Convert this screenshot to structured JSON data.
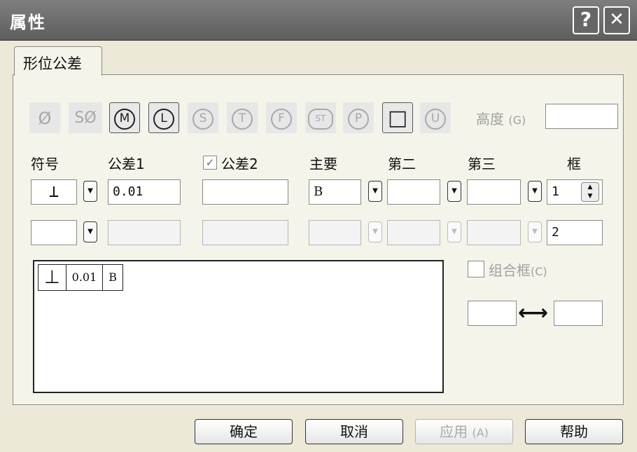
{
  "window": {
    "title": "属性",
    "help_glyph": "?",
    "close_glyph": "✕"
  },
  "tab": {
    "label": "形位公差"
  },
  "symbols": [
    {
      "name": "diameter",
      "text": "Ø",
      "state": "disabled"
    },
    {
      "name": "spherical-diameter",
      "text": "SØ",
      "state": "disabled"
    },
    {
      "name": "m",
      "text": "M",
      "state": "on"
    },
    {
      "name": "l",
      "text": "L",
      "state": "on"
    },
    {
      "name": "s",
      "text": "S",
      "state": "disabled"
    },
    {
      "name": "t",
      "text": "T",
      "state": "disabled"
    },
    {
      "name": "f",
      "text": "F",
      "state": "disabled"
    },
    {
      "name": "st",
      "text": "ST",
      "state": "disabled"
    },
    {
      "name": "p",
      "text": "P",
      "state": "disabled"
    },
    {
      "name": "square",
      "text": "□",
      "state": "on"
    },
    {
      "name": "u",
      "text": "U",
      "state": "disabled"
    }
  ],
  "height": {
    "label": "高度",
    "accel": "(G)",
    "value": ""
  },
  "headers": {
    "symbol": "符号",
    "tol1": "公差1",
    "tol2": "公差2",
    "primary": "主要",
    "second": "第二",
    "third": "第三",
    "frame": "框"
  },
  "tol2_checked": true,
  "row1": {
    "symbol": "⊥",
    "tol1": "0.01",
    "tol2": "",
    "primary": "B",
    "second": "",
    "third": "",
    "frame": "1"
  },
  "row2": {
    "symbol": "",
    "tol1": "",
    "tol2": "",
    "primary": "",
    "second": "",
    "third": "",
    "frame": "2"
  },
  "preview": {
    "symbol": "⊥",
    "value": "0.01",
    "datum": "B"
  },
  "composite": {
    "label": "组合框",
    "accel": "(C)",
    "checked": false,
    "left": "",
    "right": "",
    "arrow": "⟷"
  },
  "buttons": {
    "ok": "确定",
    "cancel": "取消",
    "apply": "应用",
    "apply_accel": "(A)",
    "help": "帮助"
  }
}
